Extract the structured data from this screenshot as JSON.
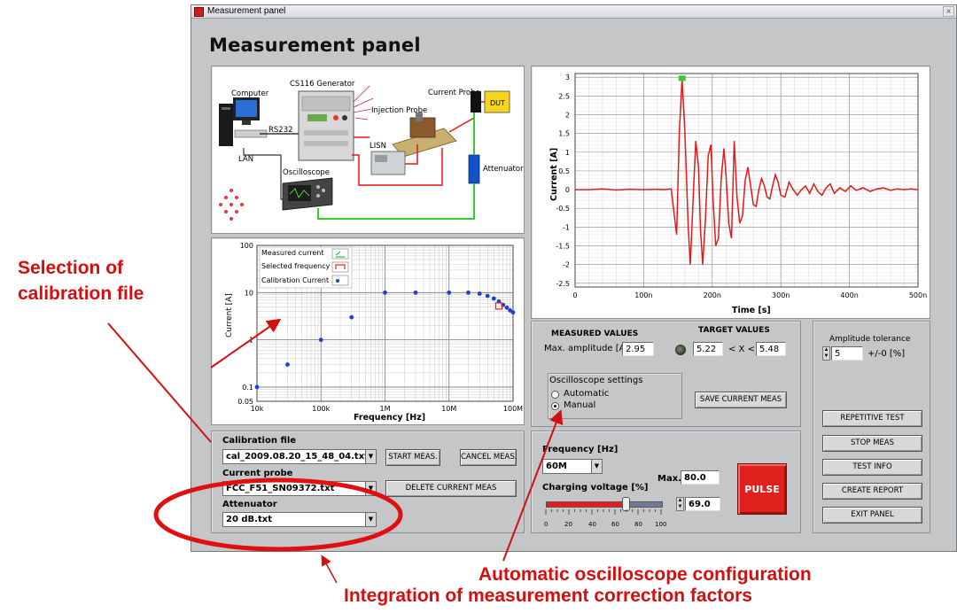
{
  "window": {
    "title": "Measurement panel",
    "heading": "Measurement panel",
    "close_symbol": "×"
  },
  "setup_diagram": {
    "computer": "Computer",
    "rs232": "RS232",
    "lan": "LAN",
    "generator": "CS116 Generator",
    "current_probe": "Current Probe",
    "injection_probe": "Injection Probe",
    "dut": "DUT",
    "lisn": "LISN",
    "oscilloscope": "Oscilloscope",
    "attenuator": "Attenuator"
  },
  "cal_chart": {
    "ylabel": "Current [A]",
    "xlabel": "Frequency [Hz]",
    "yticks": [
      "100",
      "10",
      "1",
      "0.1",
      "0.05"
    ],
    "xticks": [
      "10k",
      "100k",
      "1M",
      "10M",
      "100M"
    ],
    "legend": [
      "Measured current",
      "Selected frequency",
      "Calibration Current"
    ]
  },
  "wave_chart": {
    "ylabel": "Current [A]",
    "xlabel": "Time [s]",
    "yticks": [
      "3",
      "2.5",
      "2",
      "1.5",
      "1",
      "0.5",
      "0",
      "-0.5",
      "-1",
      "-1.5",
      "-2",
      "-2.5"
    ],
    "xticks": [
      "0",
      "100n",
      "200n",
      "300n",
      "400n",
      "500n"
    ]
  },
  "chart_data": [
    {
      "type": "scatter",
      "title": "",
      "xlabel": "Frequency [Hz]",
      "ylabel": "Current [A]",
      "x_scale": "log",
      "y_scale": "log",
      "xlim": [
        10000,
        100000000
      ],
      "ylim": [
        0.05,
        100
      ],
      "grid": true,
      "legend_position": "top-left",
      "series": [
        {
          "name": "Calibration Current",
          "points": [
            [
              10000,
              0.1
            ],
            [
              30000,
              0.3
            ],
            [
              100000,
              1
            ],
            [
              300000,
              3
            ],
            [
              1000000,
              10
            ],
            [
              3000000,
              10
            ],
            [
              10000000,
              10
            ],
            [
              20000000,
              10
            ],
            [
              30000000,
              9.5
            ],
            [
              40000000,
              8.5
            ],
            [
              50000000,
              7.5
            ],
            [
              60000000,
              6.5
            ],
            [
              70000000,
              5.5
            ],
            [
              80000000,
              4.8
            ],
            [
              90000000,
              4.2
            ],
            [
              100000000,
              3.8
            ]
          ]
        },
        {
          "name": "Selected frequency",
          "points": [
            [
              60000000,
              5.2
            ]
          ]
        }
      ]
    },
    {
      "type": "line",
      "title": "",
      "xlabel": "Time [s]",
      "ylabel": "Current [A]",
      "xlim": [
        0,
        500
      ],
      "x_unit": "ns",
      "ylim": [
        -2.6,
        3.1
      ],
      "grid": true,
      "series": [
        {
          "name": "",
          "points": [
            [
              0,
              0
            ],
            [
              20,
              0
            ],
            [
              40,
              0.02
            ],
            [
              60,
              -0.01
            ],
            [
              80,
              0.01
            ],
            [
              100,
              0
            ],
            [
              120,
              0.01
            ],
            [
              130,
              0
            ],
            [
              140,
              0.02
            ],
            [
              148,
              -1.2
            ],
            [
              152,
              1.5
            ],
            [
              156,
              2.95
            ],
            [
              160,
              1.6
            ],
            [
              165,
              -1.0
            ],
            [
              168,
              -2.0
            ],
            [
              172,
              -0.3
            ],
            [
              176,
              1.3
            ],
            [
              180,
              0.6
            ],
            [
              183,
              -1.1
            ],
            [
              186,
              -2.0
            ],
            [
              190,
              -0.8
            ],
            [
              194,
              0.9
            ],
            [
              198,
              1.2
            ],
            [
              201,
              -0.2
            ],
            [
              205,
              -1.5
            ],
            [
              209,
              -1.3
            ],
            [
              213,
              0.3
            ],
            [
              217,
              1.1
            ],
            [
              220,
              0.4
            ],
            [
              224,
              -0.9
            ],
            [
              228,
              -1.3
            ],
            [
              232,
              1.3
            ],
            [
              236,
              -0.2
            ],
            [
              240,
              -0.9
            ],
            [
              244,
              -0.7
            ],
            [
              248,
              0.25
            ],
            [
              252,
              0.6
            ],
            [
              256,
              0.1
            ],
            [
              260,
              -0.4
            ],
            [
              264,
              -0.45
            ],
            [
              268,
              0.0
            ],
            [
              272,
              0.3
            ],
            [
              276,
              0.1
            ],
            [
              280,
              -0.2
            ],
            [
              284,
              -0.25
            ],
            [
              288,
              0.1
            ],
            [
              292,
              0.4
            ],
            [
              296,
              0.2
            ],
            [
              300,
              -0.15
            ],
            [
              306,
              -0.2
            ],
            [
              312,
              0.2
            ],
            [
              318,
              0.0
            ],
            [
              324,
              -0.15
            ],
            [
              330,
              0.0
            ],
            [
              336,
              0.1
            ],
            [
              342,
              -0.1
            ],
            [
              348,
              0.15
            ],
            [
              354,
              -0.05
            ],
            [
              360,
              -0.15
            ],
            [
              366,
              0.05
            ],
            [
              372,
              0.15
            ],
            [
              378,
              -0.1
            ],
            [
              386,
              0.05
            ],
            [
              394,
              -0.05
            ],
            [
              402,
              0.1
            ],
            [
              410,
              -0.02
            ],
            [
              420,
              0.05
            ],
            [
              430,
              -0.05
            ],
            [
              440,
              0.02
            ],
            [
              450,
              0.05
            ],
            [
              460,
              -0.02
            ],
            [
              470,
              0.02
            ],
            [
              480,
              0
            ],
            [
              490,
              0.02
            ],
            [
              500,
              0
            ]
          ]
        }
      ]
    }
  ],
  "measured": {
    "title": "MEASURED VALUES",
    "max_amp_label": "Max. amplitude [A]",
    "max_amp_value": "2.95",
    "target_title": "TARGET VALUES",
    "target_low": "5.22",
    "target_range_text": "< X <",
    "target_high": "5.48"
  },
  "osc": {
    "title": "Oscilloscope settings",
    "opt_auto": "Automatic",
    "opt_manual": "Manual",
    "selected": "Manual",
    "save_btn": "SAVE CURRENT MEAS"
  },
  "tolerance": {
    "label": "Amplitude tolerance",
    "value": "5",
    "suffix": "+/-0 [%]"
  },
  "right_buttons": [
    "REPETITIVE TEST",
    "STOP MEAS",
    "TEST INFO",
    "CREATE REPORT",
    "EXIT PANEL"
  ],
  "files": {
    "cal_label": "Calibration file",
    "cal_value": "cal_2009.08.20_15_48_04.txt",
    "probe_label": "Current probe",
    "probe_value": "FCC_F51_SN09372.txt",
    "att_label": "Attenuator",
    "att_value": "20 dB.txt",
    "start_btn": "START MEAS.",
    "cancel_btn": "CANCEL MEAS.",
    "delete_btn": "DELETE CURRENT MEAS"
  },
  "pulse": {
    "freq_label": "Frequency [Hz]",
    "freq_value": "60M",
    "max_label": "Max.",
    "max_value": "80.0",
    "volt_label": "Charging voltage  [%]",
    "volt_value": "69.0",
    "volt_level": 69,
    "slider_ticks": [
      "0",
      "20",
      "40",
      "60",
      "80",
      "100"
    ],
    "pulse_btn": "PULSE"
  },
  "annotations": {
    "sel_cal": "Selection of\ncalibration file",
    "auto_osc": "Automatic oscilloscope configuration",
    "integration": "Integration of measurement  correction factors"
  },
  "colors": {
    "window_bg": "#c4c6c8",
    "annotation": "#d40f0f",
    "pulse_button": "#e0201c",
    "cal_points": "#1f3fd8",
    "waveform": "#e01a1a"
  }
}
